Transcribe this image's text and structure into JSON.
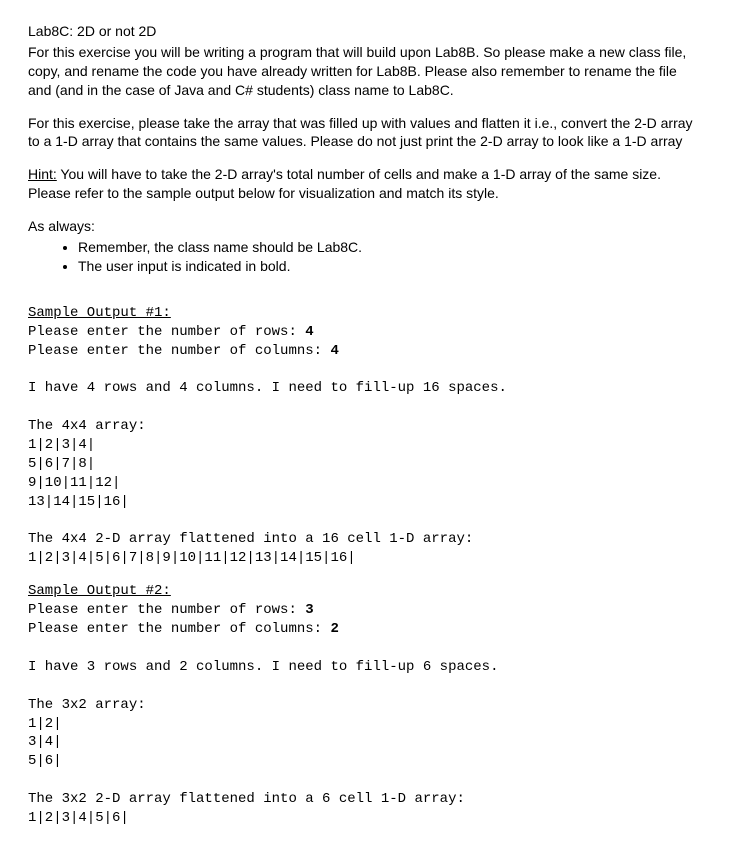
{
  "title": "Lab8C: 2D or not 2D",
  "intro_p1": "For this exercise you will be writing a program that will build upon Lab8B. So please make a new class file, copy, and rename the code you have already written for Lab8B. Please also remember to rename the file and (and in the case of Java and C# students) class name to Lab8C.",
  "intro_p2": "For this exercise, please take the array that was filled up with values and flatten it i.e., convert the 2-D array to a 1-D array that contains the same values. Please do not just print the 2-D array to look like a 1-D array",
  "hint_label": "Hint:",
  "hint_text": " You will have to take the 2-D array's total number of cells and make a 1-D array of the same size. Please refer to the sample output below for visualization and match its style.",
  "as_always_label": "As always:",
  "bullets": [
    "Remember, the class name should be Lab8C.",
    "The user input is indicated in bold."
  ],
  "sample1": {
    "heading": "Sample Output #1:",
    "prompt_rows": "Please enter the number of rows: ",
    "rows_value": "4",
    "prompt_cols": "Please enter the number of columns: ",
    "cols_value": "4",
    "info_line": "I have 4 rows and 4 columns. I need to fill-up 16 spaces.",
    "array_header": "The 4x4 array:",
    "row1": "1|2|3|4|",
    "row2": "5|6|7|8|",
    "row3": "9|10|11|12|",
    "row4": "13|14|15|16|",
    "flat_header": "The 4x4 2-D array flattened into a 16 cell 1-D array:",
    "flat_row": "1|2|3|4|5|6|7|8|9|10|11|12|13|14|15|16|"
  },
  "sample2": {
    "heading": "Sample Output #2:",
    "prompt_rows": "Please enter the number of rows: ",
    "rows_value": "3",
    "prompt_cols": "Please enter the number of columns: ",
    "cols_value": "2",
    "info_line": "I have 3 rows and 2 columns. I need to fill-up 6 spaces.",
    "array_header": "The 3x2 array:",
    "row1": "1|2|",
    "row2": "3|4|",
    "row3": "5|6|",
    "flat_header": "The 3x2 2-D array flattened into a 6 cell 1-D array:",
    "flat_row": "1|2|3|4|5|6|"
  }
}
